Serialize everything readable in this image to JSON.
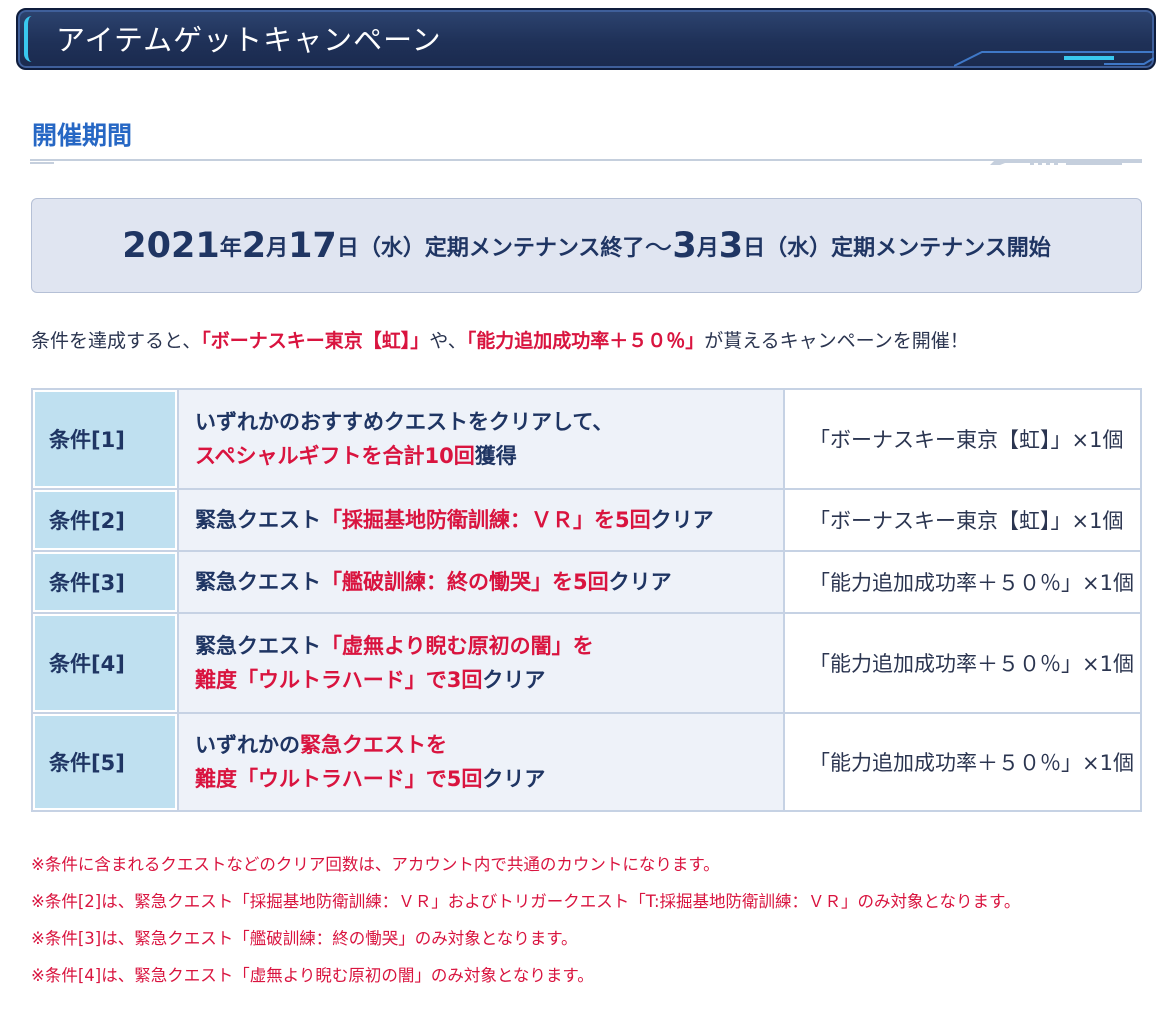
{
  "banner": {
    "title": "アイテムゲットキャンペーン"
  },
  "period": {
    "heading": "開催期間",
    "start_year": "2021",
    "start_year_unit": "年",
    "start_month": "2",
    "month_unit": "月",
    "start_day": "17",
    "day_unit": "日",
    "start_weekday": "（水）",
    "start_event": "定期メンテナンス終了",
    "separator": " ～",
    "end_month": "3",
    "end_day": "3",
    "end_weekday": "（水）",
    "end_event": "定期メンテナンス開始"
  },
  "intro": {
    "part1": "条件を達成すると、",
    "item1": "「ボーナスキー東京【虹】」",
    "part2": "や、",
    "item2": "「能力追加成功率＋５０％」",
    "part3": "が貰えるキャンペーンを開催！"
  },
  "conditions": [
    {
      "label": "条件[1]",
      "line1": [
        {
          "text": "いずれかのおすすめクエストをクリアして、",
          "red": false
        }
      ],
      "line2": [
        {
          "text": "スペシャルギフトを合計10回",
          "red": true
        },
        {
          "text": "獲得",
          "red": false
        }
      ],
      "reward": "「ボーナスキー東京【虹】」×1個"
    },
    {
      "label": "条件[2]",
      "line1": [
        {
          "text": "緊急クエスト",
          "red": false
        },
        {
          "text": "「採掘基地防衛訓練：ＶＲ」を5回",
          "red": true
        },
        {
          "text": "クリア",
          "red": false
        }
      ],
      "line2": [],
      "reward": "「ボーナスキー東京【虹】」×1個"
    },
    {
      "label": "条件[3]",
      "line1": [
        {
          "text": "緊急クエスト",
          "red": false
        },
        {
          "text": "「艦破訓練：終の慟哭」を5回",
          "red": true
        },
        {
          "text": "クリア",
          "red": false
        }
      ],
      "line2": [],
      "reward": "「能力追加成功率＋５０％」×1個"
    },
    {
      "label": "条件[4]",
      "line1": [
        {
          "text": "緊急クエスト",
          "red": false
        },
        {
          "text": "「虚無より睨む原初の闇」を",
          "red": true
        }
      ],
      "line2": [
        {
          "text": "難度「ウルトラハード」で3回",
          "red": true
        },
        {
          "text": "クリア",
          "red": false
        }
      ],
      "reward": "「能力追加成功率＋５０％」×1個"
    },
    {
      "label": "条件[5]",
      "line1": [
        {
          "text": "いずれかの",
          "red": false
        },
        {
          "text": "緊急クエストを",
          "red": true
        }
      ],
      "line2": [
        {
          "text": "難度「ウルトラハード」で5回",
          "red": true
        },
        {
          "text": "クリア",
          "red": false
        }
      ],
      "reward": "「能力追加成功率＋５０％」×1個"
    }
  ],
  "notes": [
    "※条件に含まれるクエストなどのクリア回数は、アカウント内で共通のカウントになります。",
    "※条件[2]は、緊急クエスト「採掘基地防衛訓練：ＶＲ」およびトリガークエスト「T:採掘基地防衛訓練：ＶＲ」のみ対象となります。",
    "※条件[3]は、緊急クエスト「艦破訓練：終の慟哭」のみ対象となります。",
    "※条件[4]は、緊急クエスト「虚無より睨む原初の闇」のみ対象となります。"
  ],
  "colors": {
    "accent_blue": "#2667c4",
    "highlight_red": "#d9143f",
    "banner_navy": "#1f3158",
    "banner_cyan": "#39c7ee"
  }
}
